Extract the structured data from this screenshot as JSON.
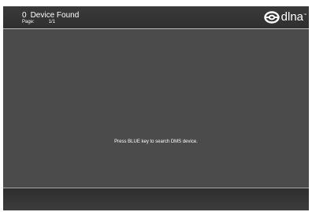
{
  "header": {
    "device_count": "0",
    "title": "Device Found",
    "page_label": "Page:",
    "page_value": "1/1"
  },
  "logo": {
    "text": "dlna",
    "icon": "dlna-logo-icon"
  },
  "content": {
    "message": "Press BLUE key to search DMS device."
  },
  "colors": {
    "background": "#4a4a4a",
    "header": "#333333",
    "text": "#ffffff",
    "divider": "#bdbdbd"
  }
}
